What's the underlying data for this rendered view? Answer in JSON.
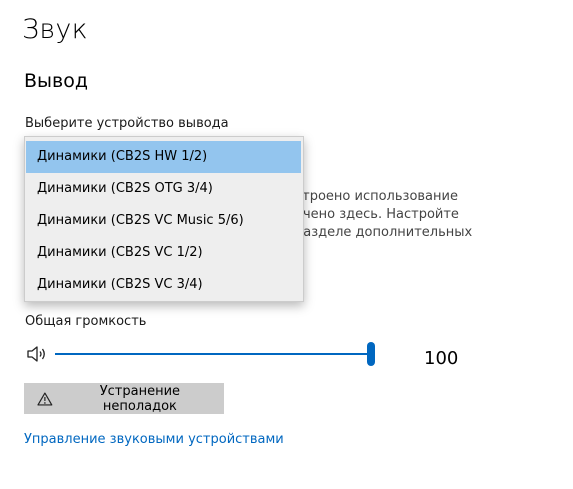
{
  "page": {
    "title": "Звук"
  },
  "output": {
    "section_title": "Вывод",
    "device_label": "Выберите устройство вывода",
    "devices": [
      {
        "label": "Динамики (CB2S HW 1/2)",
        "selected": true
      },
      {
        "label": "Динамики (CB2S OTG 3/4)",
        "selected": false
      },
      {
        "label": "Динамики (CB2S VC Music 5/6)",
        "selected": false
      },
      {
        "label": "Динамики (CB2S VC 1/2)",
        "selected": false
      },
      {
        "label": "Динамики (CB2S VC 3/4)",
        "selected": false
      }
    ],
    "partial_description": {
      "line1": "строено использование",
      "line2": "ечено здесь. Настройте",
      "line3": "разделе дополнительных"
    },
    "volume_label": "Общая громкость",
    "volume_value": "100",
    "volume_fraction": 1.0,
    "speaker_icon": "speaker-icon",
    "troubleshoot_label": "Устранение неполадок",
    "troubleshoot_icon": "warning-icon",
    "manage_link": "Управление звуковыми устройствами"
  },
  "colors": {
    "accent": "#0067c0",
    "selection": "#93c5ee",
    "button_bg": "#cccccc",
    "dropdown_bg": "#eeeeee"
  }
}
